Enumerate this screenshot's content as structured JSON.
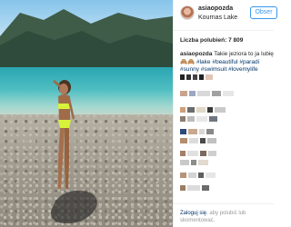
{
  "post": {
    "username": "asiaopozda",
    "location": "Kournas Lake",
    "follow_label": "Obser",
    "likes_label": "Liczba polubień: 7 809"
  },
  "caption": {
    "author": "asiaopozda",
    "text": "Takie jeziora to ja lubię",
    "emoji_line": "🙈🙈 #lake #beautiful #paradi",
    "tags_line2": "#sunny #swimsuit #lovemylife",
    "tags_line1": "#lake #beautiful #paradi"
  },
  "footer": {
    "login_link": "Zaloguj się",
    "login_rest": ", aby polubić lub",
    "login_line2": "skomentować."
  },
  "colors": {
    "accent": "#3897f0",
    "link": "#003569",
    "text": "#262626"
  },
  "icons": {
    "avatar": "avatar-photo",
    "figure": "person-in-swimsuit"
  }
}
